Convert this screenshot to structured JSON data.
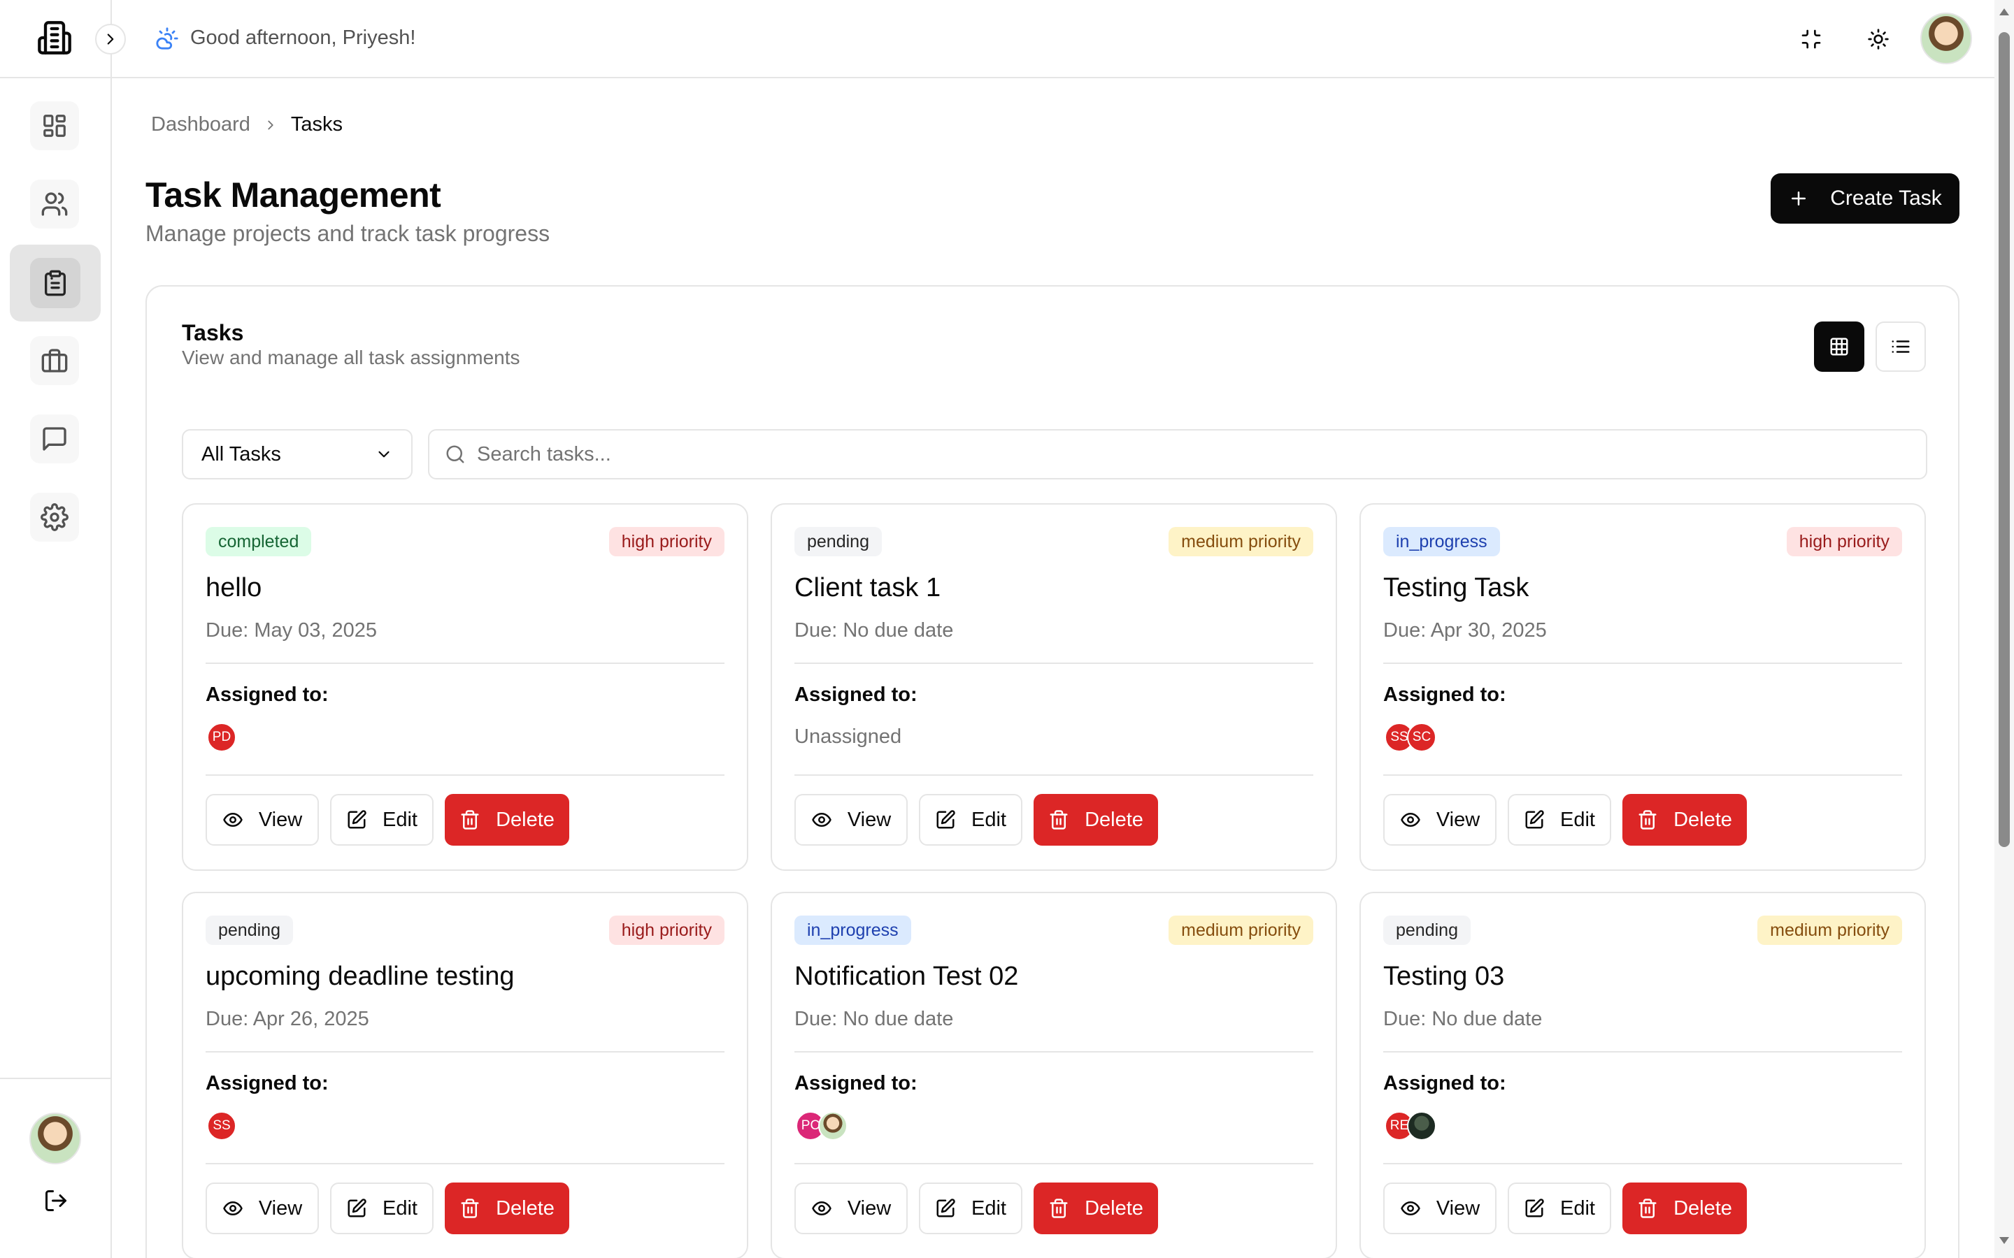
{
  "header": {
    "greeting": "Good afternoon, Priyesh!"
  },
  "sidebar": {
    "items": [
      {
        "name": "dashboard",
        "icon": "layout-grid-icon"
      },
      {
        "name": "users",
        "icon": "users-icon"
      },
      {
        "name": "tasks",
        "icon": "clipboard-icon",
        "active": true
      },
      {
        "name": "projects",
        "icon": "briefcase-icon"
      },
      {
        "name": "messages",
        "icon": "message-square-icon"
      },
      {
        "name": "settings",
        "icon": "gear-icon"
      }
    ]
  },
  "breadcrumb": {
    "parent": "Dashboard",
    "current": "Tasks"
  },
  "page": {
    "title": "Task Management",
    "subtitle": "Manage projects and track task progress",
    "create_label": "Create Task"
  },
  "tasks_panel": {
    "title": "Tasks",
    "subtitle": "View and manage all task assignments",
    "filter_value": "All Tasks",
    "search_placeholder": "Search tasks..."
  },
  "labels": {
    "assigned_to": "Assigned to:",
    "view": "View",
    "edit": "Edit",
    "delete": "Delete"
  },
  "colors": {
    "primary": "#0a0a0a",
    "danger": "#dc2626",
    "completed_bg": "#dcfce7",
    "completed_fg": "#166534",
    "pending_bg": "#f3f4f6",
    "pending_fg": "#262626",
    "in_progress_bg": "#dbeafe",
    "in_progress_fg": "#1e40af",
    "high_bg": "#fee2e2",
    "high_fg": "#991b1b",
    "medium_bg": "#fef3c7",
    "medium_fg": "#854d0e"
  },
  "tasks": [
    {
      "status": "completed",
      "priority": "high priority",
      "title": "hello",
      "due": "Due: May 03, 2025",
      "assignees": [
        {
          "initials": "PD",
          "color": "#dc2626"
        }
      ]
    },
    {
      "status": "pending",
      "priority": "medium priority",
      "title": "Client task 1",
      "due": "Due: No due date",
      "assignees": [],
      "unassigned": "Unassigned"
    },
    {
      "status": "in_progress",
      "priority": "high priority",
      "title": "Testing Task",
      "due": "Due: Apr 30, 2025",
      "assignees": [
        {
          "initials": "SS",
          "color": "#dc2626"
        },
        {
          "initials": "SC",
          "color": "#dc2626"
        }
      ]
    },
    {
      "status": "pending",
      "priority": "high priority",
      "title": "upcoming deadline testing",
      "due": "Due: Apr 26, 2025",
      "assignees": [
        {
          "initials": "SS",
          "color": "#dc2626"
        }
      ]
    },
    {
      "status": "in_progress",
      "priority": "medium priority",
      "title": "Notification Test 02",
      "due": "Due: No due date",
      "assignees": [
        {
          "initials": "PC",
          "color": "#db2777"
        },
        {
          "initials": "",
          "photo": "light"
        }
      ]
    },
    {
      "status": "pending",
      "priority": "medium priority",
      "title": "Testing 03",
      "due": "Due: No due date",
      "assignees": [
        {
          "initials": "RE",
          "color": "#dc2626"
        },
        {
          "initials": "",
          "photo": "dark"
        }
      ]
    }
  ]
}
